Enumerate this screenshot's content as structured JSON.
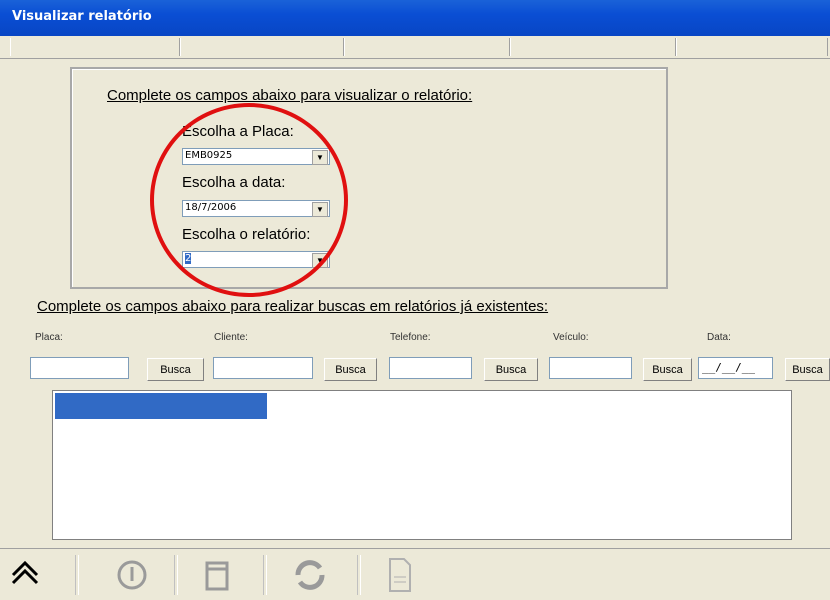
{
  "window": {
    "title": "Visualizar relatório"
  },
  "report_panel": {
    "title": "Complete os campos abaixo para visualizar o relatório:",
    "placa_label": "Escolha a Placa:",
    "placa_value": "EMB0925",
    "data_label": "Escolha a data:",
    "data_value": "18/7/2006",
    "relatorio_label": "Escolha o relatório:",
    "relatorio_value": "2"
  },
  "search": {
    "title": "Complete os campos abaixo para realizar buscas em relatórios já existentes:",
    "fields": [
      {
        "label": "Placa:",
        "value": "",
        "button": "Busca"
      },
      {
        "label": "Cliente:",
        "value": "",
        "button": "Busca"
      },
      {
        "label": "Telefone:",
        "value": "",
        "button": "Busca"
      },
      {
        "label": "Veículo:",
        "value": "",
        "button": "Busca"
      },
      {
        "label": "Data:",
        "value": "__/__/__",
        "button": "Busca"
      }
    ]
  },
  "toolbar": {
    "icons": [
      "up-arrow-icon",
      "power-icon",
      "window-icon",
      "refresh-icon",
      "document-icon"
    ]
  },
  "colors": {
    "accent": "#316ac5",
    "annotation": "#e01010",
    "titlebar": "#0a4ed4"
  }
}
